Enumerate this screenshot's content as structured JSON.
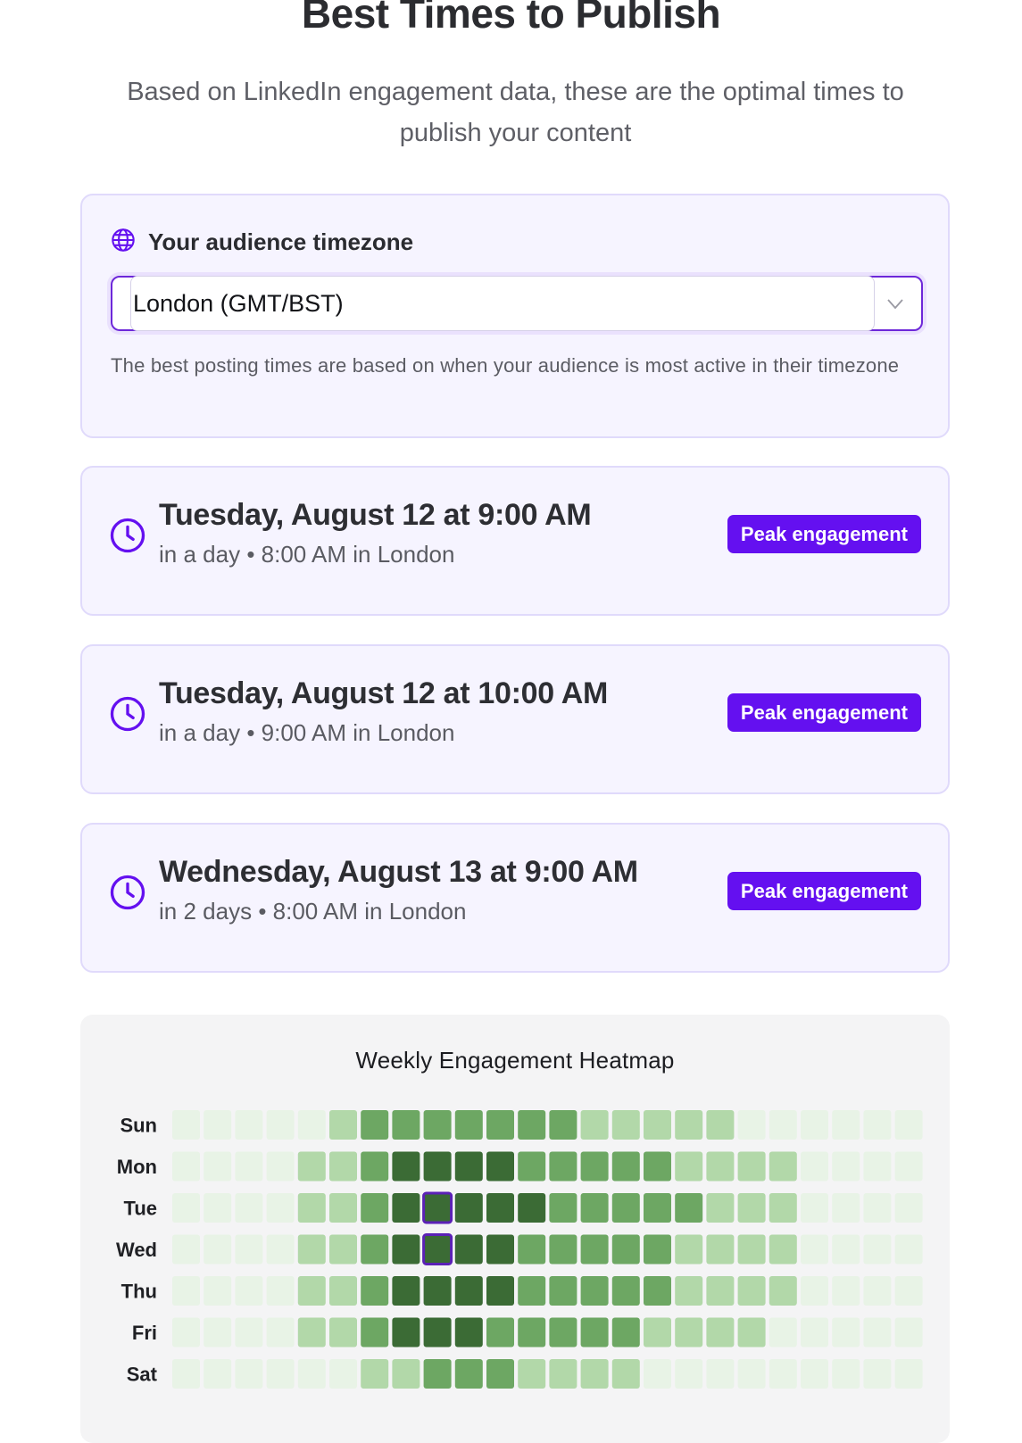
{
  "header": {
    "title": "Best Times to Publish",
    "subtitle": "Based on LinkedIn engagement data, these are the optimal times to publish your content"
  },
  "timezone": {
    "label": "Your audience timezone",
    "selected": "London (GMT/BST)",
    "hint": "The best posting times are based on when your audience is most active in their timezone"
  },
  "slots": [
    {
      "title": "Tuesday, August 12 at 9:00 AM",
      "relative": "in a day",
      "local": "8:00 AM in London",
      "badge": "Peak engagement"
    },
    {
      "title": "Tuesday, August 12 at 10:00 AM",
      "relative": "in a day",
      "local": "9:00 AM in London",
      "badge": "Peak engagement"
    },
    {
      "title": "Wednesday, August 13 at 9:00 AM",
      "relative": "in 2 days",
      "local": "8:00 AM in London",
      "badge": "Peak engagement"
    }
  ],
  "colors": {
    "accent": "#6410f0",
    "level0": "#e8f3e6",
    "level1": "#b2d8a9",
    "level2": "#6da763",
    "level3": "#3b6b35",
    "highlight": "#5b21b6"
  },
  "chart_data": {
    "type": "heatmap",
    "title": "Weekly Engagement Heatmap",
    "y": [
      "Sun",
      "Mon",
      "Tue",
      "Wed",
      "Thu",
      "Fri",
      "Sat"
    ],
    "x_count": 24,
    "levels": [
      [
        0,
        0,
        0,
        0,
        0,
        1,
        2,
        2,
        2,
        2,
        2,
        2,
        2,
        1,
        1,
        1,
        1,
        1,
        0,
        0,
        0,
        0,
        0,
        0
      ],
      [
        0,
        0,
        0,
        0,
        1,
        1,
        2,
        3,
        3,
        3,
        3,
        2,
        2,
        2,
        2,
        2,
        1,
        1,
        1,
        1,
        0,
        0,
        0,
        0
      ],
      [
        0,
        0,
        0,
        0,
        1,
        1,
        2,
        3,
        3,
        3,
        3,
        3,
        2,
        2,
        2,
        2,
        2,
        1,
        1,
        1,
        0,
        0,
        0,
        0
      ],
      [
        0,
        0,
        0,
        0,
        1,
        1,
        2,
        3,
        3,
        3,
        3,
        2,
        2,
        2,
        2,
        2,
        1,
        1,
        1,
        1,
        0,
        0,
        0,
        0
      ],
      [
        0,
        0,
        0,
        0,
        1,
        1,
        2,
        3,
        3,
        3,
        3,
        2,
        2,
        2,
        2,
        2,
        1,
        1,
        1,
        1,
        0,
        0,
        0,
        0
      ],
      [
        0,
        0,
        0,
        0,
        1,
        1,
        2,
        3,
        3,
        3,
        2,
        2,
        2,
        2,
        2,
        1,
        1,
        1,
        1,
        0,
        0,
        0,
        0,
        0
      ],
      [
        0,
        0,
        0,
        0,
        0,
        0,
        1,
        1,
        2,
        2,
        2,
        1,
        1,
        1,
        1,
        0,
        0,
        0,
        0,
        0,
        0,
        0,
        0,
        0
      ]
    ],
    "highlighted": [
      [
        2,
        8
      ],
      [
        3,
        8
      ]
    ],
    "grid": false,
    "legend": "none"
  }
}
